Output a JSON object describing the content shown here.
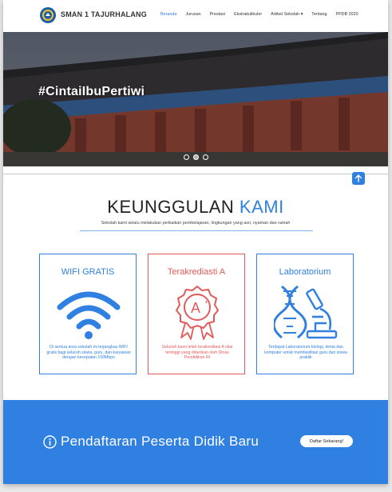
{
  "nav": {
    "brand": "SMAN 1 TAJURHALANG",
    "items": [
      {
        "label": "Beranda",
        "active": true
      },
      {
        "label": "Jurusan",
        "active": false
      },
      {
        "label": "Prestasi",
        "active": false
      },
      {
        "label": "Ekstrakulikuler",
        "active": false
      },
      {
        "label": "Artikel Sekolah ▾",
        "active": false
      },
      {
        "label": "Tentang",
        "active": false
      },
      {
        "label": "PPDB 2020",
        "active": false
      }
    ]
  },
  "hero": {
    "tagline": "#CintaiIbuPertiwi",
    "slide_count": 3,
    "active_slide": 2
  },
  "features": {
    "title_main": "KEUNGGULAN ",
    "title_highlight": "KAMI",
    "subtitle": "Sekolah kami selalu melakukan perbaikan pembelajaran, lingkungan yang asri, nyaman dan ramah",
    "cards": [
      {
        "title": "WIFI GRATIS",
        "icon": "wifi-icon",
        "text": "Di semua area sekolah ini terjangkau WIFI gratis bagi seluruh siswa, guru, dan karyawan dengan kecepatan 100Mbps"
      },
      {
        "title": "Terakrediasti A",
        "icon": "award-badge-icon",
        "text": "Sekolah kami telah terakreditasi A nilai tertinggi yang diberikan oleh Dinas Pendidikan RI"
      },
      {
        "title": "Laboratorium",
        "icon": "dna-microscope-icon",
        "text": "Terdapat Laboratorium biologi, kimia dan komputer untuk memfasilitasi guru dan siswa praktik"
      }
    ]
  },
  "banner": {
    "text": "Pendaftaran Peserta Didik Baru",
    "button": "Daftar Sekarang!"
  },
  "colors": {
    "accent": "#2f80e0",
    "red": "#e35a5a"
  }
}
